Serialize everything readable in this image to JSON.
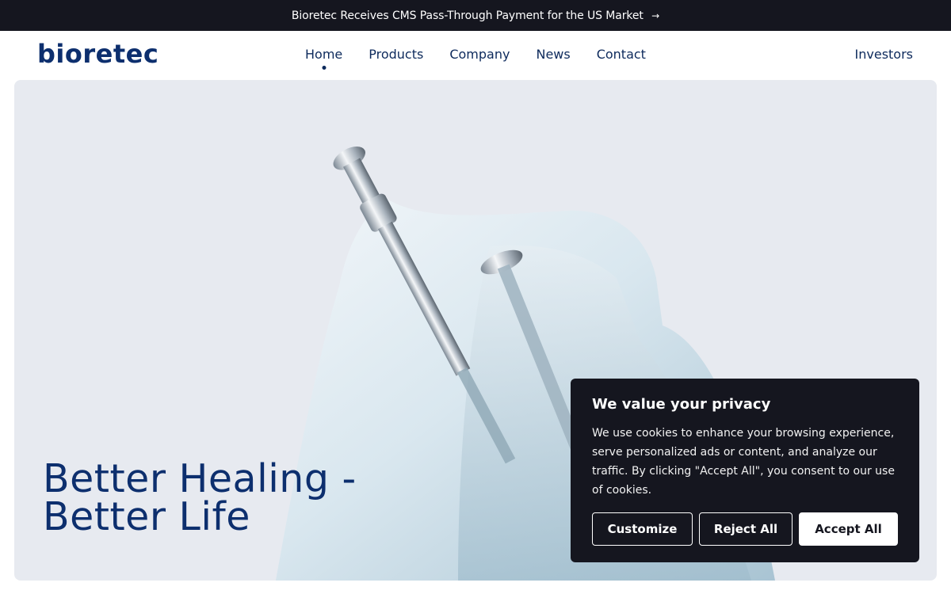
{
  "announcement": {
    "text": "Bioretec Receives CMS Pass-Through Payment for the US Market",
    "arrow": "→"
  },
  "header": {
    "logo": "bioretec",
    "nav": [
      {
        "label": "Home",
        "active": true
      },
      {
        "label": "Products"
      },
      {
        "label": "Company"
      },
      {
        "label": "News"
      },
      {
        "label": "Contact"
      }
    ],
    "investors": "Investors"
  },
  "hero": {
    "title_line1": "Better Healing -",
    "title_line2": "Better Life"
  },
  "cookie": {
    "title": "We value your privacy",
    "body": "We use cookies to enhance your browsing experience, serve personalized ads or content, and analyze our traffic. By clicking \"Accept All\", you consent to our use of cookies.",
    "customize": "Customize",
    "reject": "Reject All",
    "accept": "Accept All"
  },
  "colors": {
    "brand": "#0d2f6e",
    "dark": "#15161f",
    "hero_bg": "#e7eaf0"
  }
}
